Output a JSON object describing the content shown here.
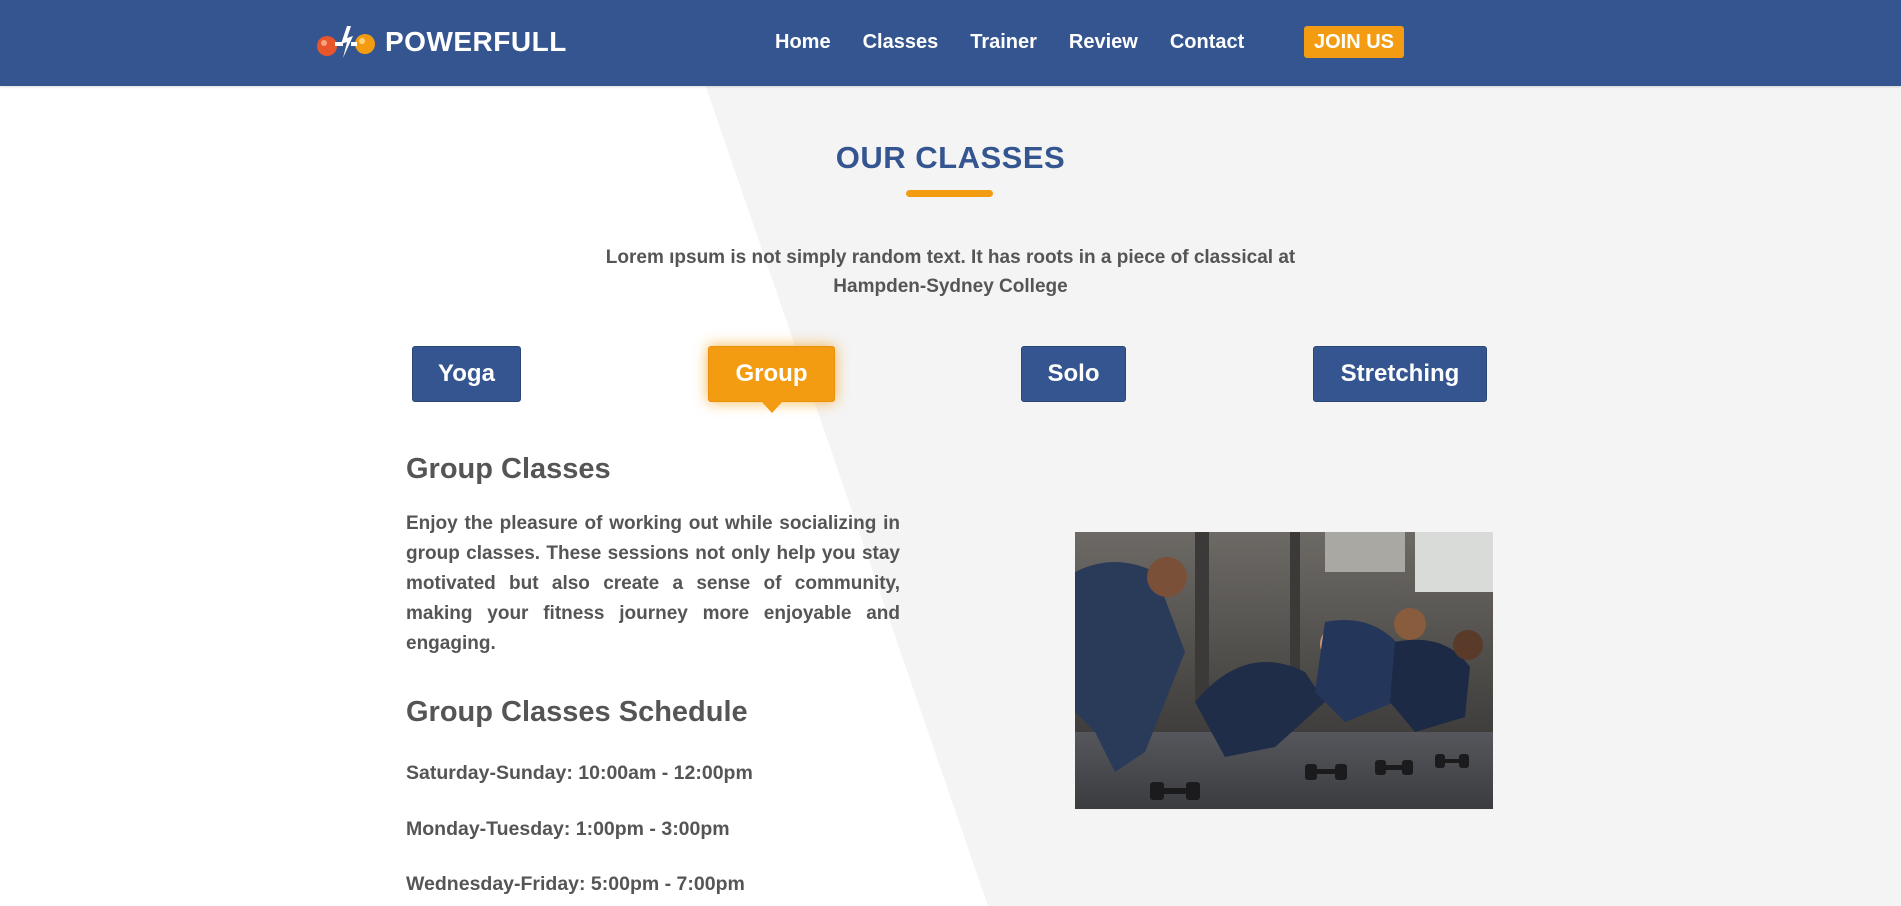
{
  "brand": {
    "name": "POWERFULL"
  },
  "nav": {
    "items": [
      {
        "label": "Home"
      },
      {
        "label": "Classes"
      },
      {
        "label": "Trainer"
      },
      {
        "label": "Review"
      },
      {
        "label": "Contact"
      }
    ],
    "cta": "JOIN US"
  },
  "section": {
    "title": "OUR CLASSES",
    "intro_line1": "Lorem ıpsum is not simply random text. It has roots in a piece of classical at",
    "intro_line2": "Hampden-Sydney College"
  },
  "tabs": [
    {
      "label": "Yoga",
      "active": false
    },
    {
      "label": "Group",
      "active": true
    },
    {
      "label": "Solo",
      "active": false
    },
    {
      "label": "Stretching",
      "active": false
    }
  ],
  "content": {
    "heading": "Group Classes",
    "description": "Enjoy the pleasure of working out while socializing in group classes. These sessions not only help you stay motivated but also create a sense of community, making your fitness journey more enjoyable and engaging.",
    "schedule_heading": "Group Classes Schedule",
    "schedule": [
      "Saturday-Sunday: 10:00am - 12:00pm",
      "Monday-Tuesday: 1:00pm - 3:00pm",
      "Wednesday-Friday: 5:00pm - 7:00pm"
    ]
  },
  "colors": {
    "primary": "#34558f",
    "accent": "#f39c12",
    "text": "#555555",
    "background_light": "#f4f4f4",
    "background_white": "#ffffff"
  }
}
